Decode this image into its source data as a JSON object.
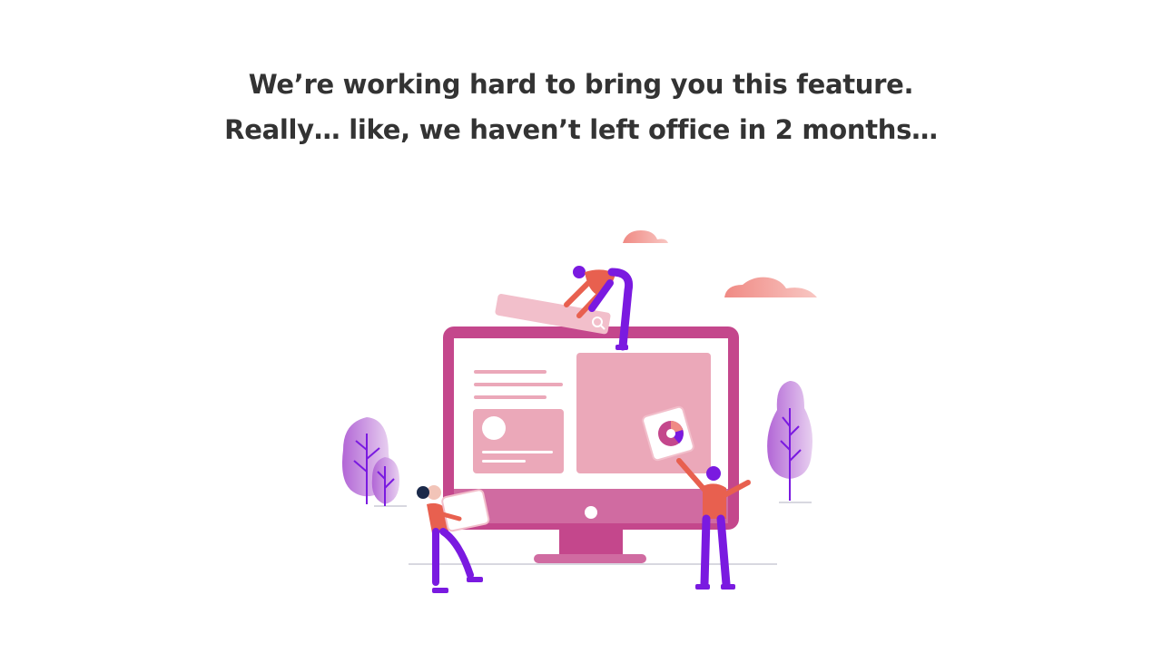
{
  "message": {
    "line1": "We’re working hard to bring you this feature.",
    "line2": "Really… like, we haven’t left office in 2 months…"
  },
  "illustration": {
    "subject": "people assembling a website on a desktop monitor",
    "icons": [
      "cloud-icon",
      "search-icon",
      "pie-chart-icon",
      "tree-icon"
    ],
    "colors": {
      "monitor_frame": "#c4478c",
      "monitor_stand": "#d06ba1",
      "panel": "#eba8b9",
      "cloud": "#f08a84",
      "person_shirt": "#e8604f",
      "person_pants": "#7a1ae0",
      "tree": "#b266d6",
      "text": "#333333"
    }
  }
}
